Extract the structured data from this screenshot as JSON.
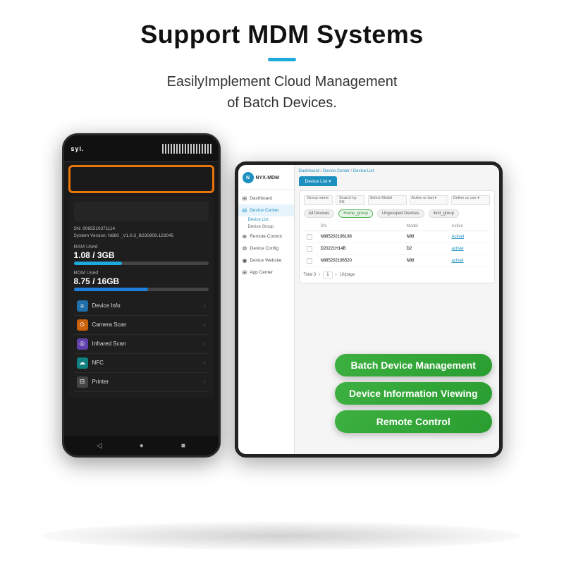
{
  "page": {
    "title": "Support MDM Systems",
    "accent_bar": true,
    "subtitle_line1": "EasilyImplement Cloud Management",
    "subtitle_line2": "of Batch Devices."
  },
  "phone": {
    "logo": "syi.",
    "sn_label": "SN: 9085510371114",
    "system_version": "System Version: N880 _V1.0.3_B230909.123045",
    "ram_label": "RAM Used",
    "ram_value": "1.08 / 3GB",
    "rom_label": "ROM Used",
    "rom_value": "8.75 / 16GB",
    "menu_items": [
      {
        "label": "Device Info",
        "icon": "≡"
      },
      {
        "label": "Camera Scan",
        "icon": "⊙"
      },
      {
        "label": "Infrared Scan",
        "icon": "◎"
      },
      {
        "label": "NFC",
        "icon": "☁"
      },
      {
        "label": "Printer",
        "icon": "⊟"
      }
    ]
  },
  "tablet": {
    "breadcrumb": "Dashboard / Device Center / Device List",
    "nav_items": [
      {
        "label": "Dashboard",
        "icon": "⊞"
      },
      {
        "label": "Device Center",
        "icon": "⊟"
      },
      {
        "label": "Device List",
        "sub": true
      },
      {
        "label": "Device Group",
        "sub": true
      },
      {
        "label": "Remote Control",
        "icon": "⊕"
      },
      {
        "label": "Device Config",
        "icon": "⚙"
      },
      {
        "label": "Device Website",
        "icon": "◉"
      },
      {
        "label": "App Center",
        "icon": "⊞"
      }
    ],
    "tab_label": "Device List ▾",
    "filter": {
      "group_placeholder": "Group name",
      "search_placeholder": "Search by SN",
      "model_placeholder": "Select Model",
      "status_placeholder": "Active or last ▾",
      "scope_placeholder": "Online sc use ▾"
    },
    "groups": [
      "All Devices",
      "Home_group",
      "Ungrouped Devices",
      "limit_group"
    ],
    "table": {
      "headers": [
        "",
        "SN",
        "Model",
        "Active"
      ],
      "rows": [
        {
          "sn": "N885202196198",
          "model": "N88",
          "active": "Activel"
        },
        {
          "sn": "D20221H14B",
          "model": "D2",
          "active": "activel"
        },
        {
          "sn": "N885202196520",
          "model": "N88",
          "active": "activel"
        }
      ]
    },
    "pagination": {
      "total": "Total 3",
      "page": "1",
      "per_page": "10/page"
    }
  },
  "pills": [
    {
      "label": "Batch Device Management"
    },
    {
      "label": "Device Information Viewing"
    },
    {
      "label": "Remote Control"
    }
  ]
}
